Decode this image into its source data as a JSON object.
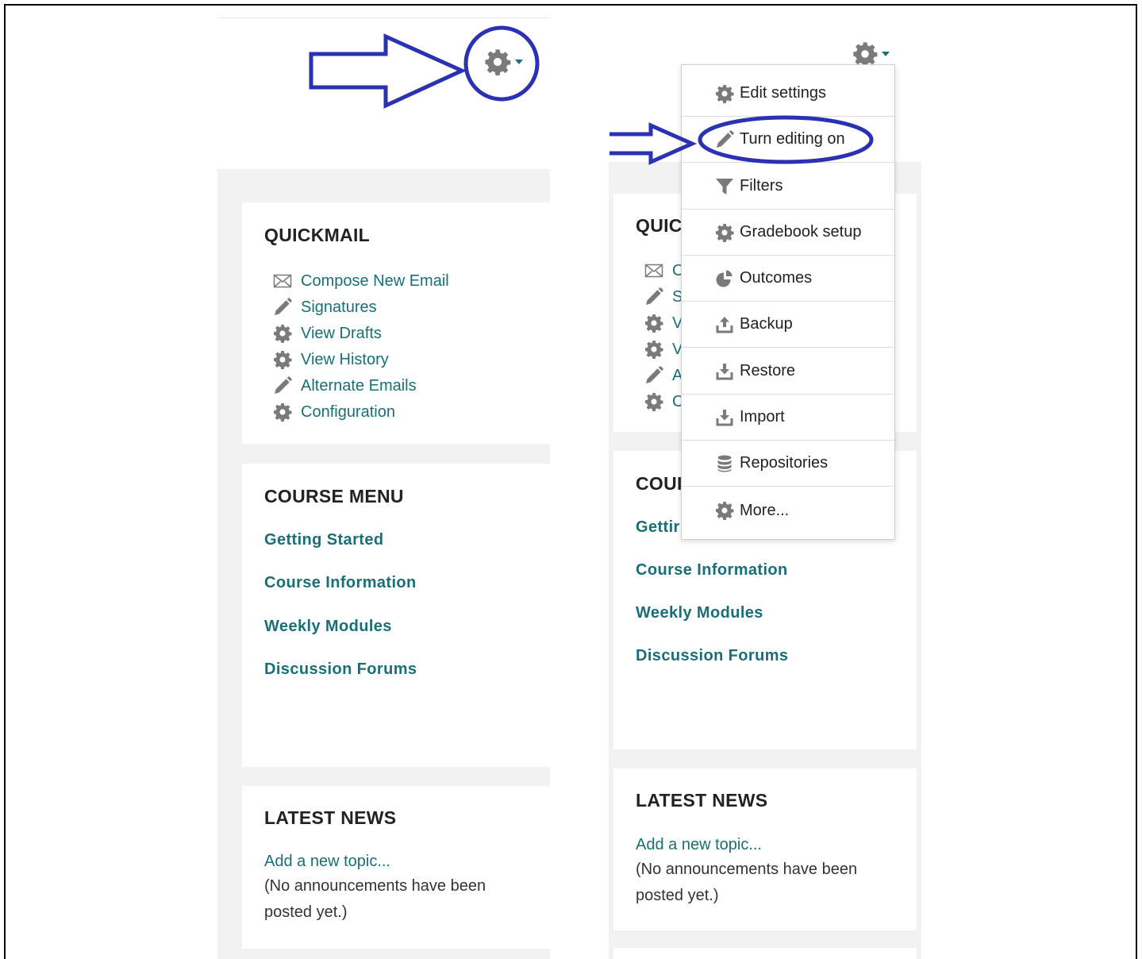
{
  "left": {
    "quickmail": {
      "title": "QUICKMAIL",
      "items": [
        {
          "label": "Compose New Email",
          "icon": "envelope-icon"
        },
        {
          "label": "Signatures",
          "icon": "pencil-icon"
        },
        {
          "label": "View Drafts",
          "icon": "gear-icon"
        },
        {
          "label": "View History",
          "icon": "gear-icon"
        },
        {
          "label": "Alternate Emails",
          "icon": "pencil-icon"
        },
        {
          "label": "Configuration",
          "icon": "gear-icon"
        }
      ]
    },
    "course_menu": {
      "title": "COURSE MENU",
      "links": [
        "Getting Started",
        "Course Information",
        "Weekly Modules",
        "Discussion Forums"
      ]
    },
    "latest_news": {
      "title": "LATEST NEWS",
      "add_link": "Add a new topic...",
      "empty_text": "(No announcements have been posted yet.)"
    }
  },
  "right": {
    "quickmail": {
      "title_visible": "QUIC",
      "item_initials": [
        "C",
        "S",
        "V",
        "V",
        "A",
        "C"
      ]
    },
    "course_menu": {
      "title_visible": "COUI",
      "first_link_visible": "Gettir",
      "links": [
        "Course Information",
        "Weekly Modules",
        "Discussion Forums"
      ]
    },
    "latest_news": {
      "title": "LATEST NEWS",
      "add_link": "Add a new topic...",
      "empty_text": "(No announcements have been posted yet.)"
    }
  },
  "settings_menu": {
    "items": [
      {
        "label": "Edit settings",
        "icon": "gear-icon"
      },
      {
        "label": "Turn editing on",
        "icon": "pencil-icon"
      },
      {
        "label": "Filters",
        "icon": "filter-icon"
      },
      {
        "label": "Gradebook setup",
        "icon": "gear-icon"
      },
      {
        "label": "Outcomes",
        "icon": "pie-chart-icon"
      },
      {
        "label": "Backup",
        "icon": "upload-icon"
      },
      {
        "label": "Restore",
        "icon": "download-icon"
      },
      {
        "label": "Import",
        "icon": "download-icon"
      },
      {
        "label": "Repositories",
        "icon": "database-icon"
      },
      {
        "label": "More...",
        "icon": "gear-icon"
      }
    ]
  },
  "colors": {
    "link": "#1a6e75",
    "annotation": "#2b32b2",
    "icon_gray": "#7a7a7a",
    "page_gray": "#f2f2f2"
  }
}
